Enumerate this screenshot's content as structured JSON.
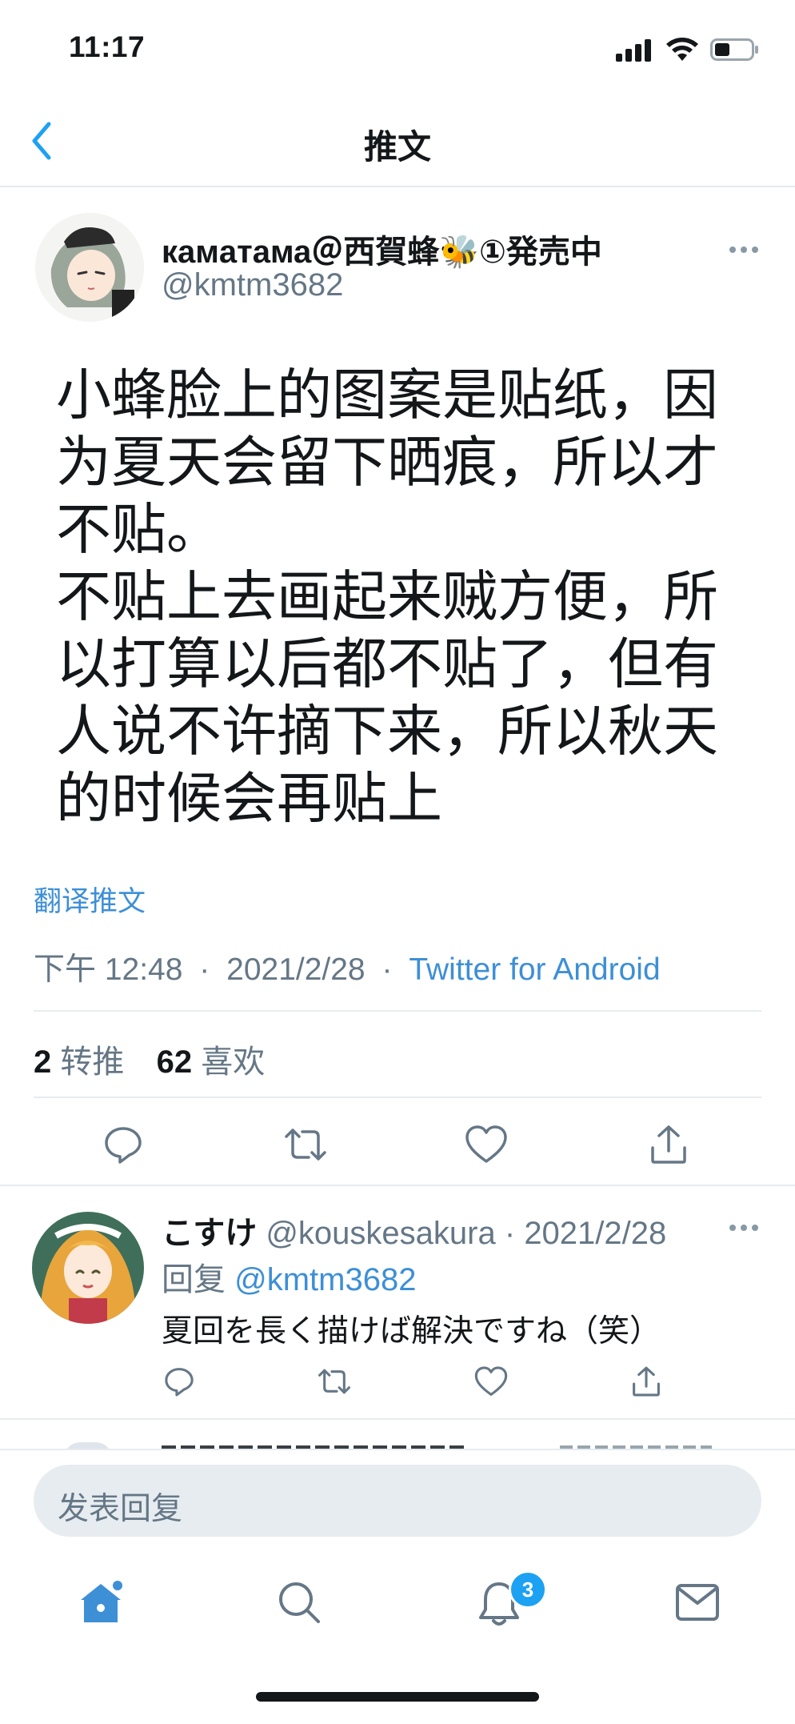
{
  "status_bar": {
    "time": "11:17"
  },
  "header": {
    "title": "推文"
  },
  "tweet": {
    "display_name": "камaтама＠西賀蜂🐝①発売中",
    "handle": "@kmtm3682",
    "text": "小蜂脸上的图案是贴纸，因\n为夏天会留下晒痕，所以才\n不贴。\n不贴上去画起来贼方便，所\n以打算以后都不贴了，但有\n人说不许摘下来，所以秋天\n的时候会再贴上",
    "translate_label": "翻译推文",
    "time": "下午 12:48",
    "date": "2021/2/28",
    "separator": "·",
    "source": "Twitter for Android",
    "retweets_count": "2",
    "retweets_label": "转推",
    "likes_count": "62",
    "likes_label": "喜欢"
  },
  "reply": {
    "name": "こすけ",
    "handle": "@kouskesakura",
    "date": "2021/2/28",
    "separator": "·",
    "reply_prefix": "回复",
    "reply_to": "@kmtm3682",
    "text": "夏回を長く描けば解決ですね（笑）"
  },
  "composer": {
    "placeholder": "发表回复"
  },
  "tabbar": {
    "items": [
      "home-icon",
      "search-icon",
      "notifications-icon",
      "messages-icon"
    ],
    "notification_badge": "3"
  },
  "colors": {
    "accent": "#1da1f2",
    "link": "#3d8fd6",
    "muted": "#657786",
    "divider": "#e6ecf0"
  }
}
